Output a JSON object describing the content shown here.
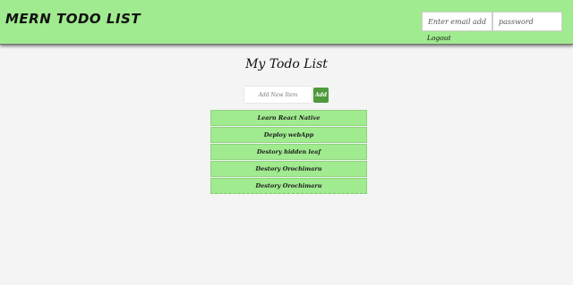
{
  "header": {
    "brand": "MERN TODO LIST",
    "email_placeholder": "Enter email address",
    "password_placeholder": "password",
    "logout_label": "Logout"
  },
  "main": {
    "title": "My Todo List",
    "add_placeholder": "Add New Item",
    "add_label": "Add",
    "items": [
      "Learn React Native",
      "Deploy webApp",
      "Destory hidden leaf",
      "Destory Orochimaru",
      "Destory Orochimaru"
    ]
  },
  "colors": {
    "header_bg": "#a0ea8f",
    "item_bg": "#a0ea8f",
    "add_button": "#4e9a3d",
    "page_bg": "#f4f4f4"
  }
}
